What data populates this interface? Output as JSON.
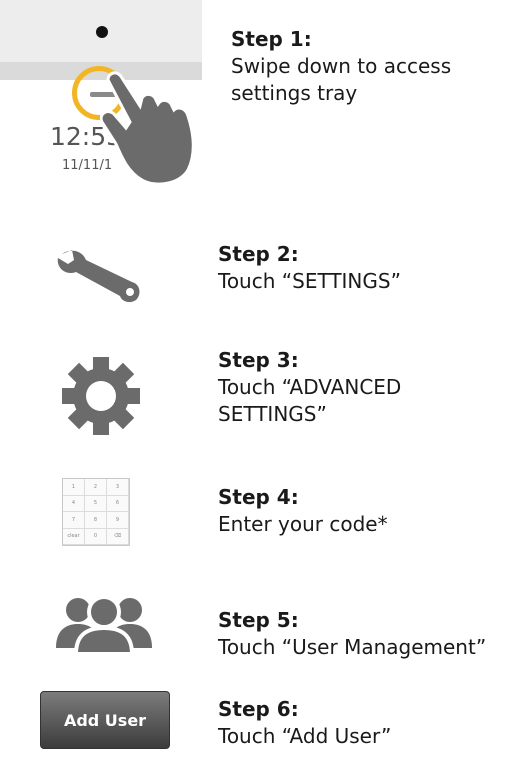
{
  "step1": {
    "title": "Step 1:",
    "line1": "Swipe down to access",
    "line2": "settings tray",
    "image": {
      "time": "12:55 F",
      "date": "11/11/1"
    }
  },
  "step2": {
    "title": "Step 2:",
    "line1": "Touch “SETTINGS”",
    "icon": "wrench-icon"
  },
  "step3": {
    "title": "Step 3:",
    "line1": "Touch “ADVANCED",
    "line2": "SETTINGS”",
    "icon": "gear-icon"
  },
  "step4": {
    "title": "Step 4:",
    "line1": "Enter your code*",
    "icon": "keypad-icon"
  },
  "step5": {
    "title": "Step 5:",
    "line1": "Touch “User Management”",
    "icon": "users-icon"
  },
  "step6": {
    "title": "Step 6:",
    "line1": "Touch “Add User”",
    "button_label": "Add User"
  },
  "colors": {
    "accent_ring": "#f2b624",
    "icon_gray": "#6b6b6b"
  }
}
